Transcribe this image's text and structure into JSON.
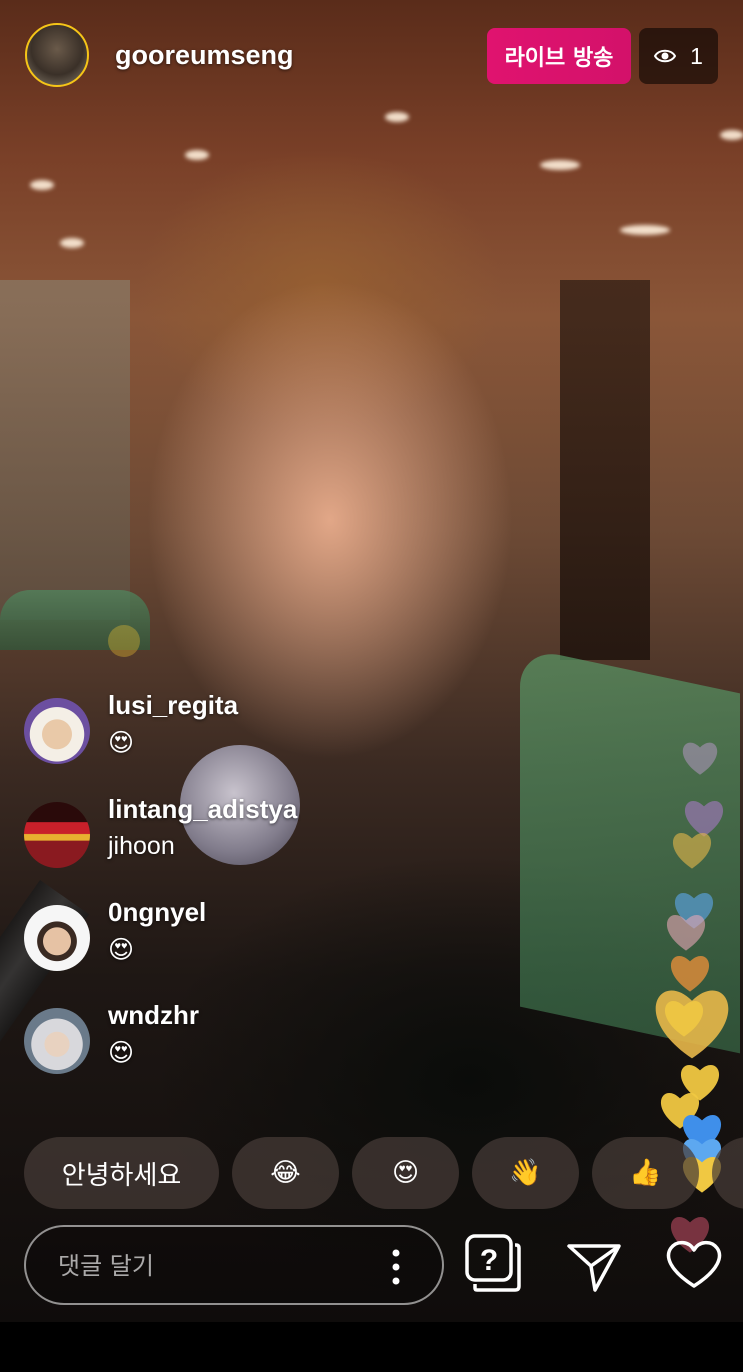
{
  "header": {
    "username": "gooreumseng",
    "live_label": "라이브 방송",
    "viewer_count": "1"
  },
  "comments": [
    {
      "username": "lusi_regita",
      "text": "😍"
    },
    {
      "username": "lintang_adistya",
      "text": "jihoon"
    },
    {
      "username": "0ngnyel",
      "text": "😍"
    },
    {
      "username": "wndzhr",
      "text": "😍"
    }
  ],
  "quick_reactions": [
    "안녕하세요",
    "😂",
    "😍",
    "👋",
    "👍"
  ],
  "comment_box": {
    "placeholder": "댓글 달기"
  },
  "icons": {
    "more": "more-vertical-icon",
    "question": "question-sticker-icon",
    "send": "paper-plane-icon",
    "like": "heart-outline-icon"
  },
  "colors": {
    "live_badge": "#e0136f",
    "viewer_badge_bg": "rgba(0,0,0,0.55)",
    "hearts": [
      "#c9a0dc",
      "#e8b84a",
      "#d98b3a",
      "#e8a7b6",
      "#5da8f0",
      "#f0c842",
      "#8b3a4a"
    ]
  }
}
